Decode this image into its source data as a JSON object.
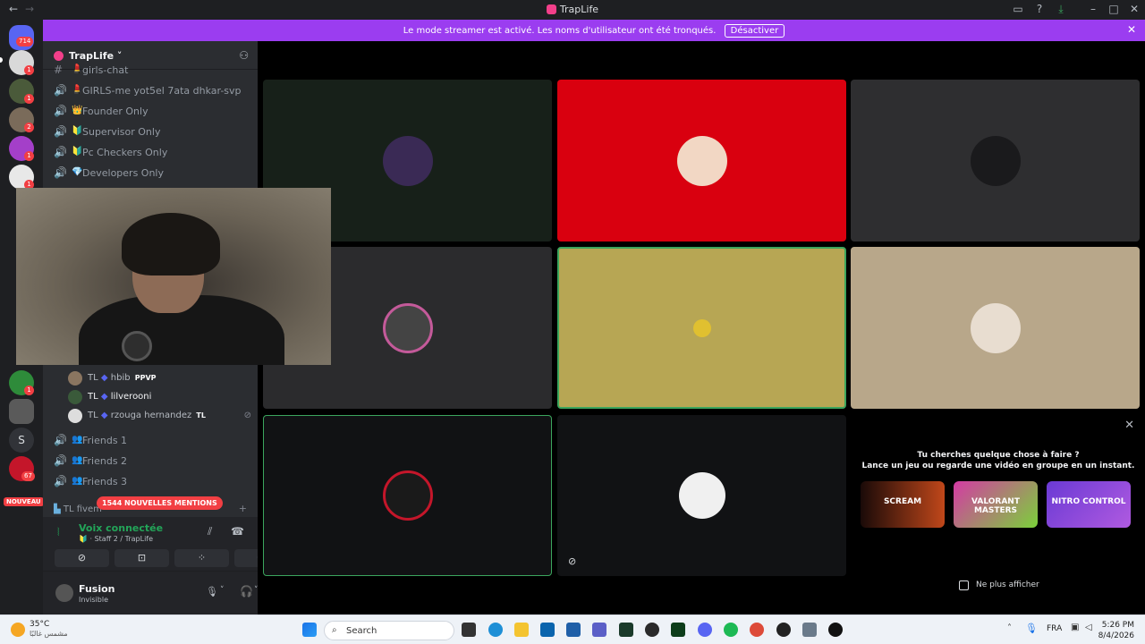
{
  "window": {
    "title": "TrapLife"
  },
  "banner": {
    "message": "Le mode streamer est activé. Les noms d'utilisateur ont été tronqués.",
    "button": "Désactiver"
  },
  "rail": {
    "top_badge": "714",
    "server_badges": [
      "1",
      "1",
      "2",
      "1",
      "1"
    ],
    "letter_server": "S",
    "bottom_badges": [
      "1",
      "67"
    ],
    "nouveau": "NOUVEAU"
  },
  "server": {
    "name": "TrapLife"
  },
  "channels": [
    {
      "label": "girls-chat",
      "emoji": "💄",
      "type": "text"
    },
    {
      "label": "GIRLS-me yot5el 7ata dhkar-svp",
      "emoji": "💄",
      "type": "voice"
    },
    {
      "label": "Founder Only",
      "emoji": "👑",
      "type": "voice"
    },
    {
      "label": "Supervisor Only",
      "emoji": "🔰",
      "type": "voice"
    },
    {
      "label": "Pc Checkers Only",
      "emoji": "🔰",
      "type": "voice"
    },
    {
      "label": "Developers Only",
      "emoji": "💎",
      "type": "voice"
    }
  ],
  "members": [
    {
      "prefix": "TL",
      "name": "hbib",
      "tag": "PPVP"
    },
    {
      "prefix": "TL",
      "name": "lilverooni",
      "tag": ""
    },
    {
      "prefix": "TL",
      "name": "rzouga hernandez",
      "tag": "TL"
    }
  ],
  "friend_channels": [
    "Friends 1",
    "Friends 2",
    "Friends 3"
  ],
  "fivem_channel": "TL fivem",
  "mentions_pill": "1544 NOUVELLES MENTIONS",
  "voice": {
    "status": "Voix connectée",
    "location": "Staff 2 / TrapLife"
  },
  "user": {
    "name": "Fusion",
    "status": "Invisible"
  },
  "activity": {
    "line1": "Tu cherches quelque chose à faire ?",
    "line2": "Lance un jeu ou regarde une vidéo en groupe en un instant.",
    "cards": [
      "SCREAM",
      "VALORANT MASTERS",
      "NITRO CONTROL"
    ],
    "checkbox_label": "Ne plus afficher"
  },
  "taskbar": {
    "weather_temp": "35°C",
    "weather_desc": "مشمس غالبًا",
    "search_placeholder": "Search",
    "lang": "FRA",
    "time": "5:26 PM",
    "date": "8/4/2026"
  },
  "colors": {
    "banner": "#9b3df0",
    "tile_red": "#d9000f",
    "tile_olive": "#b7a654",
    "tile_beige": "#b8a78a",
    "speaking": "#3ba55d"
  }
}
